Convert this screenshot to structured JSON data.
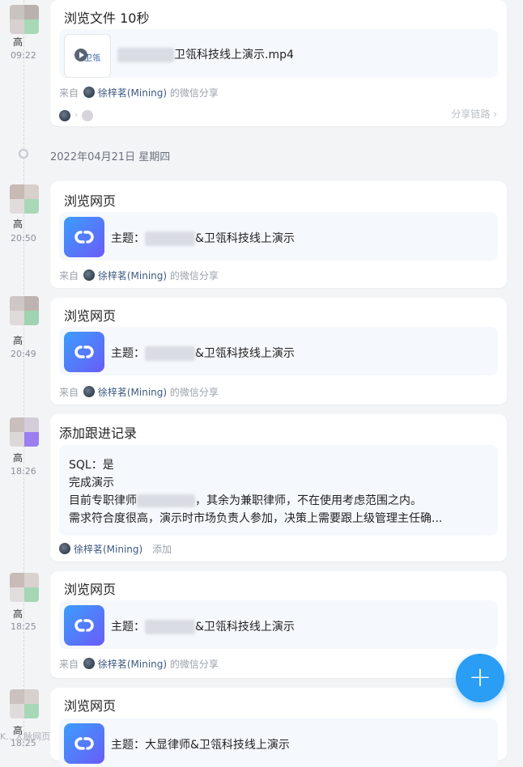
{
  "colors": {
    "accent": "#2a9df4",
    "user_link": "#3d5a80",
    "background": "#f3f4f6"
  },
  "feed": {
    "file_item": {
      "name": "高",
      "time": "09:22",
      "title": "浏览文件 10秒",
      "file_name": "卫瓴科技线上演示.mp4",
      "thumb_label": "卫瓴",
      "source_prefix": "来自",
      "source_user": "徐梓茗(Mining)",
      "source_suffix": "的微信分享",
      "share_chain": "分享链路 ›"
    },
    "date_divider": "2022年04月21日 星期四",
    "web_items": [
      {
        "name": "高",
        "time": "20:50",
        "title": "浏览网页",
        "subject_prefix": "主题：",
        "subject_suffix": "&卫瓴科技线上演示",
        "source_prefix": "来自",
        "source_user": "徐梓茗(Mining)",
        "source_suffix": "的微信分享"
      },
      {
        "name": "高",
        "time": "20:49",
        "title": "浏览网页",
        "subject_prefix": "主题：",
        "subject_suffix": "&卫瓴科技线上演示",
        "source_prefix": "来自",
        "source_user": "徐梓茗(Mining)",
        "source_suffix": "的微信分享"
      }
    ],
    "followup": {
      "name": "高",
      "time": "18:26",
      "title": "添加跟进记录",
      "lines": [
        "SQL：是",
        "完成演示",
        "目前专职律师",
        "，其余为兼职律师，不在使用考虑范围之内。",
        "需求符合度很高，演示时市场负责人参加，决策上需要跟上级管理主任确..."
      ],
      "author": "徐梓茗(Mining)",
      "action": "添加"
    },
    "web_item_3": {
      "name": "高",
      "time": "18:25",
      "title": "浏览网页",
      "subject_prefix": "主题：",
      "subject_suffix": "&卫瓴科技线上演示",
      "source_prefix": "来自",
      "source_user": "徐梓茗(Mining)",
      "source_suffix": "的微信分享"
    },
    "web_item_4": {
      "name": "高",
      "time": "18:25",
      "title": "浏览网页",
      "subject_full": "主题：大显律师&卫瓴科技线上演示"
    }
  },
  "fab": {
    "label": "+"
  },
  "watermark": "K…人脉网页"
}
